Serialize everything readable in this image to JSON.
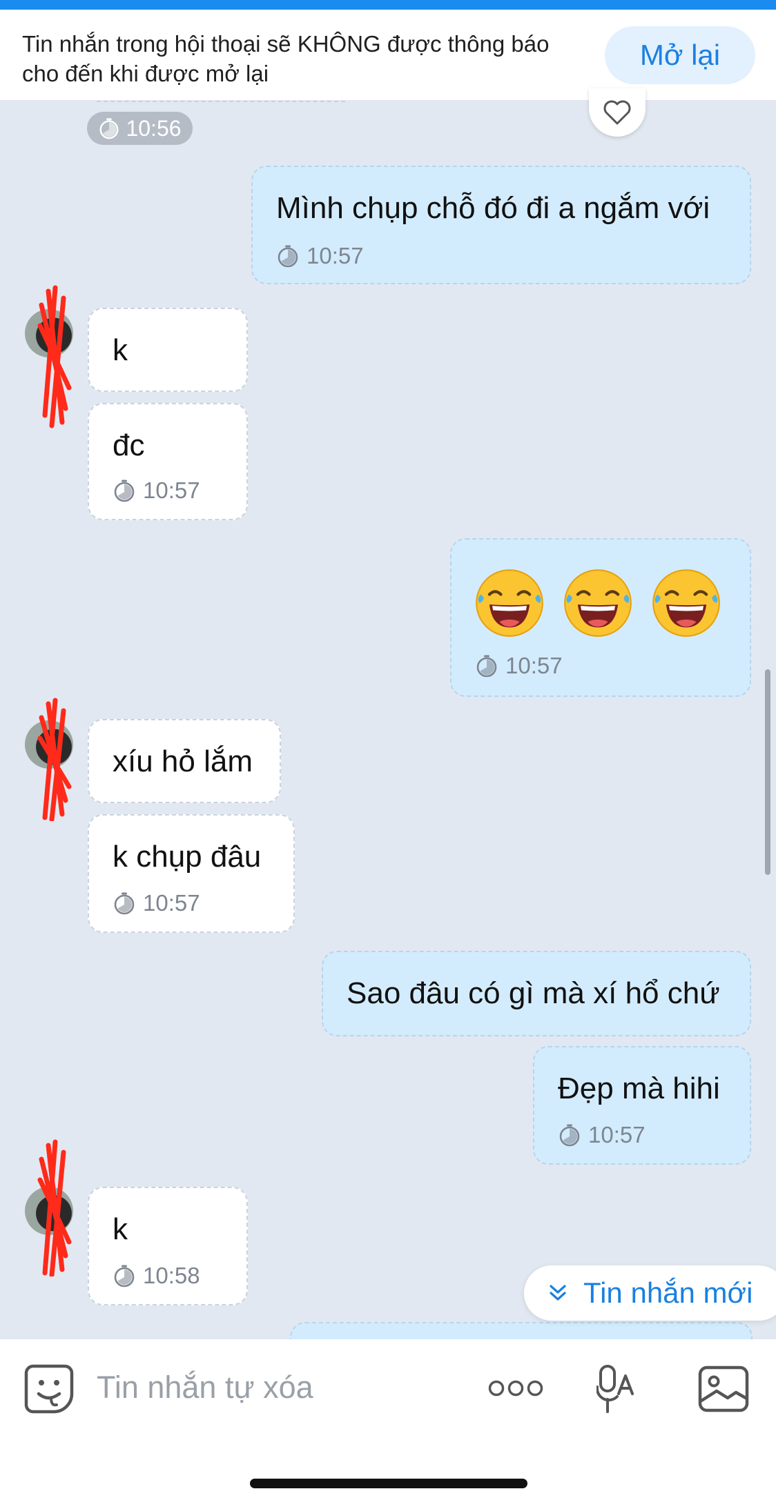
{
  "banner": {
    "notice": "Tin nhắn trong hội thoại sẽ KHÔNG được thông báo cho đến khi được mở lại",
    "reopen_label": "Mở lại"
  },
  "messages": [
    {
      "side": "system",
      "time": "10:56"
    },
    {
      "side": "out",
      "text": "Mình chụp chỗ đó đi a ngắm với",
      "time": "10:57"
    },
    {
      "side": "in",
      "text": "k"
    },
    {
      "side": "in",
      "text": "đc",
      "time": "10:57"
    },
    {
      "side": "out",
      "emoji": [
        "laughing-tears-emoji",
        "laughing-tears-emoji",
        "laughing-tears-emoji"
      ],
      "time": "10:57"
    },
    {
      "side": "in",
      "text": "xíu hỏ lắm"
    },
    {
      "side": "in",
      "text": "k chụp đâu",
      "time": "10:57"
    },
    {
      "side": "out",
      "text": "Sao đâu có gì mà xí hổ chứ"
    },
    {
      "side": "out",
      "text": "Đẹp mà hihi",
      "time": "10:57"
    },
    {
      "side": "in",
      "text": "k",
      "time": "10:58"
    }
  ],
  "new_messages_label": "Tin nhắn mới",
  "composer": {
    "placeholder": "Tin nhắn tự xóa"
  },
  "colors": {
    "accent": "#1a80e0",
    "outgoing_bubble": "#d3ecfd",
    "incoming_bubble": "#ffffff",
    "background": "#e2e8f1"
  }
}
